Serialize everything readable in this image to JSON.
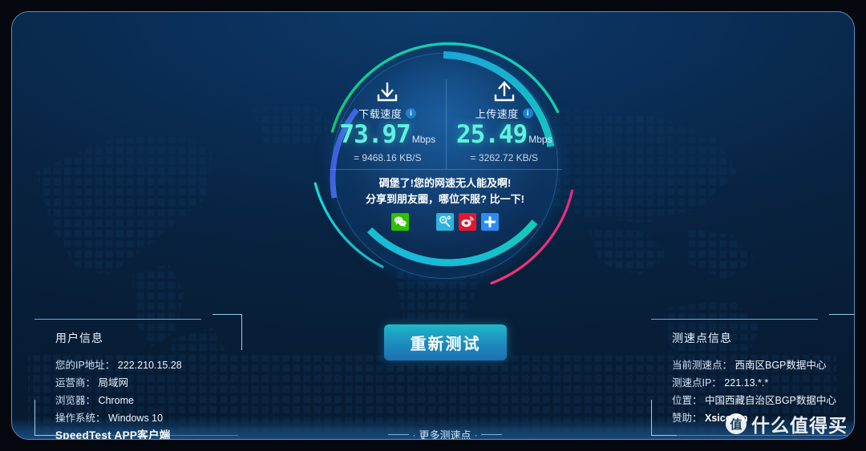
{
  "theme": {
    "bg_outer": "#05080f",
    "panel_bg_top": "#0d3a69",
    "panel_bg_bottom": "#071a30",
    "accent_cyan": "#5ff2e0",
    "accent_green": "#18c07a",
    "accent_blue": "#2f6fdc",
    "accent_pink": "#ef2b7d",
    "border_blue": "#5b8fc4",
    "button_gradient_from": "#1fb8c6",
    "button_gradient_to": "#1c6fae"
  },
  "gauge": {
    "download": {
      "icon": "download-arrow-icon",
      "label": "下载速度",
      "info_badge": "i",
      "value": "73.97",
      "unit": "Mbps",
      "sub": "= 9468.16 KB/S"
    },
    "upload": {
      "icon": "upload-arrow-icon",
      "label": "上传速度",
      "info_badge": "i",
      "value": "25.49",
      "unit": "Mbps",
      "sub": "= 3262.72 KB/S"
    }
  },
  "share": {
    "line1": "碉堡了!您的网速无人能及啊!",
    "line2": "分享到朋友圈，哪位不服? 比一下!",
    "icons": [
      {
        "name": "wechat-share-icon",
        "color": "#2dc100",
        "glyph": "wechat"
      },
      {
        "name": "qzone-share-icon",
        "color": "#2cb3e0",
        "glyph": "qzone"
      },
      {
        "name": "weibo-share-icon",
        "color": "#e6162d",
        "glyph": "weibo"
      },
      {
        "name": "more-share-icon",
        "color": "#2d8cf0",
        "glyph": "plus"
      }
    ]
  },
  "actions": {
    "retest_label": "重新测试",
    "more_points_label": "更多测速点"
  },
  "user_panel": {
    "title": "用户信息",
    "rows": [
      {
        "key": "您的IP地址：",
        "value": "222.210.15.28"
      },
      {
        "key": "运营商：",
        "value": "局域网"
      },
      {
        "key": "浏览器：",
        "value": "Chrome"
      },
      {
        "key": "操作系统：",
        "value": "Windows 10"
      }
    ],
    "app_link": "SpeedTest APP客户端"
  },
  "server_panel": {
    "title": "测速点信息",
    "rows": [
      {
        "key": "当前测速点：",
        "value": "西南区BGP数据中心"
      },
      {
        "key": "测速点IP：",
        "value": "221.13.*.*"
      },
      {
        "key": "位置：",
        "value": "中国西藏自治区BGP数据中心"
      },
      {
        "key": "赞助：",
        "value": "Xsico.Cn"
      }
    ]
  },
  "watermark": {
    "logo_glyph": "值",
    "text": "什么值得买"
  }
}
